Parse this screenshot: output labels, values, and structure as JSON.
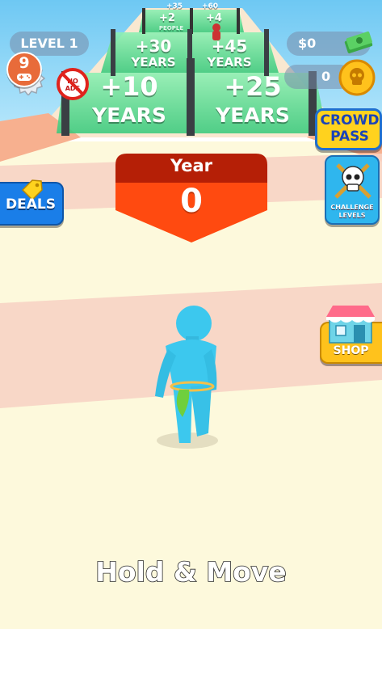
{
  "hud": {
    "level_label": "LEVEL 1",
    "cash_value": "$0",
    "coin_value": "0",
    "notification_count": "9",
    "no_ads_label": "NO ADS"
  },
  "gates": {
    "far_top_left": "+35",
    "far_top_right": "+60",
    "far_left": "+2",
    "far_right": "+4",
    "far_unit": "PEOPLE",
    "mid_left": "+30",
    "mid_right": "+45",
    "mid_unit": "YEARS",
    "near_left": "+10",
    "near_right": "+25",
    "near_unit": "YEARS"
  },
  "year_panel": {
    "title": "Year",
    "value": "0"
  },
  "side_buttons": {
    "deals": "DEALS",
    "crowd_pass_line1": "CROWD",
    "crowd_pass_line2": "PASS",
    "challenge_line1": "CHALLENGE",
    "challenge_line2": "LEVELS",
    "shop": "SHOP"
  },
  "hint": "Hold & Move",
  "colors": {
    "ground": "#fdf9dc",
    "track_stripe": "#f7d3c4",
    "year_header": "#b51f06",
    "year_body": "#ff4a10",
    "character": "#3cc8ee",
    "gate_glow": "#6fe8a0",
    "deals_blue": "#1a7ee8",
    "crowd_pass_yellow": "#ffd21e"
  }
}
